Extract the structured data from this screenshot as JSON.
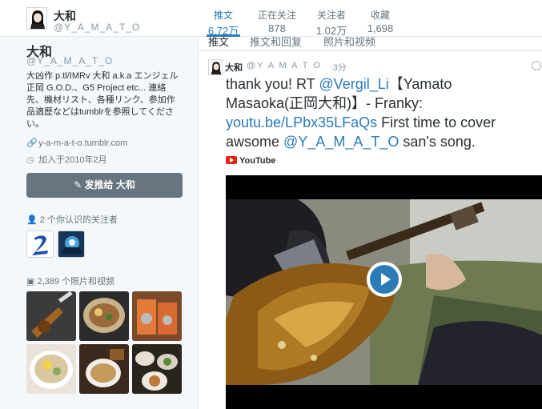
{
  "profile": {
    "name": "大和",
    "handle": "@Y_A_M_A_T_O",
    "bio": "大凶作 p.tl/IMRv 大和 a.k.a エンジェル正岡 G.O.D.、G5 Project etc... 連絡先、機材リスト、各種リンク、参加作品適歷などはtumblrを参照してください。",
    "website": "y-a-m-a-t-o.tumblr.com",
    "joined": "加入于2010年2月",
    "dm_button": "发推给 大和"
  },
  "stats": [
    {
      "label": "推文",
      "value": "6.72万"
    },
    {
      "label": "正在关注",
      "value": "878"
    },
    {
      "label": "关注者",
      "value": "1.02万"
    },
    {
      "label": "收藏",
      "value": "1,698"
    }
  ],
  "followers_you_know": {
    "title": "2 个你认识的关注者"
  },
  "photos": {
    "title": "2,389 个照片和视频"
  },
  "tabs": [
    "推文",
    "推文和回复",
    "照片和视频"
  ],
  "tweet": {
    "name": "大和",
    "handle": "@Y A M A T O",
    "time": "·3分",
    "text_1": "thank you! RT ",
    "mention_1": "@Vergil_Li",
    "text_2": "【Yamato Masaoka(正岡大和)】- Franky: ",
    "link": "youtu.be/LPbx35LFaQs",
    "text_3": " First time to cover awsome ",
    "mention_2": "@Y_A_M_A_T_O",
    "text_4": " san's song.",
    "card_source": "YouTube"
  },
  "colors": {
    "accent": "#2b7bb9",
    "dm_button": "#66757f",
    "youtube": "#e62117"
  }
}
